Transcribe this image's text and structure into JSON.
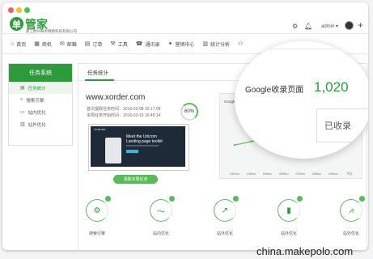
{
  "window": {
    "controls": {
      "close_color": "#f25f58",
      "min_color": "#f9be2e",
      "max_color": "#3ec94a"
    }
  },
  "brand": {
    "logo_char": "单",
    "name": "管家",
    "company": "浙江杭州奇单网络科技有限公司"
  },
  "topbar": {
    "settings_icon": "gear-icon",
    "bell_icon": "bell-icon",
    "user": "admin",
    "plus": "+"
  },
  "nav": [
    {
      "icon": "home-icon",
      "glyph": "⌂",
      "label": "首页"
    },
    {
      "icon": "shop-icon",
      "glyph": "▦",
      "label": "商机"
    },
    {
      "icon": "mail-icon",
      "glyph": "✉",
      "label": "邮箱"
    },
    {
      "icon": "order-icon",
      "glyph": "▤",
      "label": "订单"
    },
    {
      "icon": "tools-icon",
      "glyph": "⚒",
      "label": "工具"
    },
    {
      "icon": "contacts-icon",
      "glyph": "☎",
      "label": "通讯录"
    },
    {
      "icon": "marketing-icon",
      "glyph": "✦",
      "label": "营销中心"
    },
    {
      "icon": "stats-icon",
      "glyph": "▥",
      "label": "统计分析"
    },
    {
      "icon": "more-icon",
      "glyph": "⚇",
      "label": ""
    }
  ],
  "sidebar": {
    "title": "任务系统",
    "items": [
      {
        "glyph": "▤",
        "label": "任务统计"
      },
      {
        "glyph": "⌕",
        "label": "搜索引擎"
      },
      {
        "glyph": "▭",
        "label": "站内优化"
      },
      {
        "glyph": "▥",
        "label": "站外优化"
      }
    ]
  },
  "main": {
    "tab": "任务统计",
    "domain": "www.xorder.com",
    "first_time_label": "首次提取任务时间：",
    "first_time": "2016-03-08 15:17:09",
    "latest_time_label": "本周任务开始时间：",
    "latest_time": "2016-03-16 16:45:14",
    "progress": "60%",
    "progress_value": 60,
    "preview": {
      "nav": "XORDER",
      "title": "Meet the Unicorn Landing page toolkit"
    },
    "button": "领取本周任务",
    "chart_label": "Google收录",
    "magnifier": {
      "label": "Google收录页面",
      "value": "1,020",
      "box": "已收录"
    },
    "categories": [
      {
        "label": "搜索引擎",
        "glyph": "⚙",
        "icon": "search-engine-icon"
      },
      {
        "label": "站内优化",
        "glyph": "〜",
        "icon": "onsite-icon"
      },
      {
        "label": "站外优化",
        "glyph": "↗",
        "icon": "offsite-icon"
      },
      {
        "label": "站外优化",
        "glyph": "▮",
        "icon": "offsite-icon-2"
      },
      {
        "label": "站外优化",
        "glyph": "⩘",
        "icon": "offsite-icon-3"
      }
    ]
  },
  "chart_data": {
    "type": "line",
    "title": "Google收录",
    "categories": [
      "23Mon",
      "24Mon",
      "25Mon",
      "26Mon",
      "27Mon",
      "28Mon",
      "29Mon",
      "今天"
    ],
    "series": [
      {
        "name": "",
        "values": [
          40,
          46,
          52,
          68,
          75,
          88,
          92,
          95
        ]
      }
    ],
    "line_color": "#5cb85c"
  },
  "watermark": "china.makepolo.com"
}
